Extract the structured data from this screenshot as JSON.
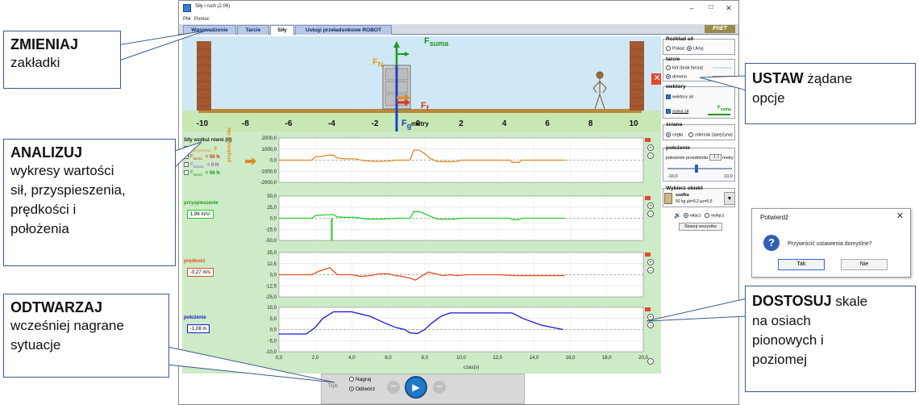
{
  "window": {
    "title": "Siły i ruch (2.06)",
    "menu": [
      "Plik",
      "Pomoc"
    ],
    "controls": {
      "minimize": "–",
      "maximize": "☐",
      "close": "✕"
    },
    "logo": "PhET"
  },
  "tabs": [
    {
      "label": "Wprowadzenie",
      "active": false
    },
    {
      "label": "Tarcie",
      "active": false
    },
    {
      "label": "Siły",
      "active": true
    },
    {
      "label": "Usługi przeładunkowe ROBOT",
      "active": false
    }
  ],
  "scene": {
    "ruler": [
      "-10",
      "-8",
      "-6",
      "-4",
      "-2",
      "0",
      "2",
      "4",
      "6",
      "8",
      "10"
    ],
    "ruler_unit": "metry",
    "forces": {
      "sum_label": "F",
      "sum_sub": "suma",
      "normal_label": "F",
      "normal_sub": "N",
      "friction_label": "F",
      "friction_sub": "f",
      "gravity_label": "F",
      "gravity_sub": "g"
    },
    "close": "✕"
  },
  "graphs": {
    "xlabel": "czas(s)",
    "x_ticks": [
      "0,0",
      "2,0",
      "4,0",
      "6,0",
      "8,0",
      "10,0",
      "12,0",
      "14,0",
      "16,0",
      "18,0",
      "20,0"
    ],
    "forces_panel": {
      "title": "Siły wzdłuż równi (N)",
      "side_label": "przyłożona siła",
      "legend": [
        {
          "name": "F",
          "sub": "przyłożona",
          "value": "0",
          "color": "#e08a20"
        },
        {
          "name": "F",
          "sub": "tarcia",
          "value": "= 98 N",
          "color": "#d43a1a"
        },
        {
          "name": "F",
          "sub": "ściana",
          "value": "= 0 N",
          "color": "#a64bd4"
        },
        {
          "name": "F",
          "sub": "suma",
          "value": "= 98 N",
          "color": "#1a9a1a"
        }
      ],
      "y_ticks": [
        "2000,0",
        "1000,0",
        "0,0",
        "-1000,0",
        "-2000,0"
      ]
    },
    "acceleration": {
      "title": "przyspieszenie",
      "value": "1,96 m/s²",
      "y_ticks": [
        "50,0",
        "25,0",
        "0,0",
        "-25,0",
        "-50,0"
      ]
    },
    "velocity": {
      "title": "prędkość",
      "value": "-0,27 m/s",
      "y_ticks": [
        "25,0",
        "12,5",
        "0,0",
        "-12,5",
        "-25,0"
      ]
    },
    "position": {
      "title": "położenie",
      "value": "-1,08 m",
      "y_ticks": [
        "10,0",
        "5,0",
        "0,0",
        "-5,0",
        "-10,0"
      ]
    },
    "zoom_in": "+",
    "zoom_out": "−"
  },
  "right_panel": {
    "force_breakdown": {
      "title": "Rozkład sił",
      "options": [
        "Pokaż",
        "Ukryj"
      ],
      "selected": "Ukryj"
    },
    "friction": {
      "title": "tarcie",
      "options": [
        "lód (brak tarcia)",
        "drewno"
      ],
      "selected": "drewno"
    },
    "vectors": {
      "title": "wektory",
      "items": [
        "wektory sił",
        "suma sił"
      ],
      "sum_label": "F",
      "sum_sub": "suma"
    },
    "wall": {
      "title": "ściana",
      "options": [
        "cegła",
        "zderzak (sprężyna)"
      ],
      "selected": "cegła"
    },
    "position": {
      "title": "położenie",
      "label": "położenie przedmiotu",
      "value": "-1,1",
      "unit": "metry",
      "min": "-10,0",
      "max": "10,0",
      "fraction": 0.445
    },
    "object": {
      "title": "Wybierz obiekt",
      "name": "szafka",
      "details": "50 kg μk=0,2 μs=0,5"
    },
    "sound": {
      "options": [
        "włącz",
        "wyłącz"
      ],
      "selected": "włącz"
    },
    "reset": "Skasuj wszystko"
  },
  "playback": {
    "record": "Nagraj",
    "play": "Odtwórz",
    "selected": "Odtwórz",
    "mode": "Tryb"
  },
  "dialog": {
    "title": "Potwierdź",
    "message": "Przywrócić ustawienia domyślne?",
    "yes": "Tak",
    "no": "Nie",
    "close": "✕"
  },
  "callouts": {
    "tabs": {
      "title": "ZMIENIAJ",
      "body": "zakładki"
    },
    "analyze": {
      "title": "ANALIZUJ",
      "body": [
        "wykresy wartości",
        "sił, przyspieszenia,",
        "prędkości i",
        "położenia"
      ]
    },
    "replay": {
      "title": "ODTWARZAJ",
      "body": [
        "wcześniej nagrane",
        "sytuacje"
      ]
    },
    "options": {
      "title": "USTAW",
      "rest": " żądane",
      "body": [
        "opcje"
      ]
    },
    "scales": {
      "title": "DOSTOSUJ",
      "rest": " skale",
      "body": [
        "na osiach",
        "pionowych i",
        "poziomej"
      ]
    }
  },
  "colors": {
    "force": "#e08a20",
    "acceleration": "#20d020",
    "velocity": "#e8501a",
    "position": "#1515d8",
    "sum": "#1a9a1a"
  }
}
